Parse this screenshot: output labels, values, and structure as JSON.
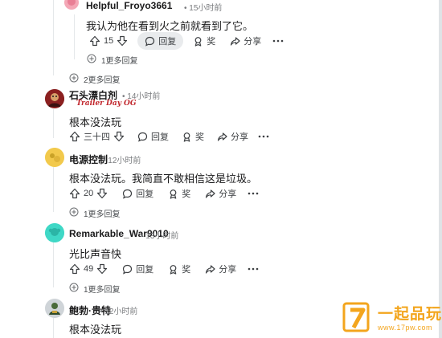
{
  "colors": {
    "watermark": "#f3a51d",
    "hover_pill": "#e9ebed",
    "thread_line": "#e5e8ea",
    "badge_text": "#c1272d"
  },
  "icons": {
    "upvote": "arrow-up-outline",
    "downvote": "arrow-down-outline",
    "reply": "speech-bubble",
    "award": "award-ribbon",
    "share": "share-arrow",
    "more": "ellipsis",
    "expand": "plus-circle"
  },
  "comments": [
    {
      "username": "Helpful_Froyo3661",
      "time": "15小时前",
      "text": "我认为他在看到火之前就看到了它。",
      "votes": "15",
      "reply_label": "回复",
      "award_label": "奖",
      "share_label": "分享",
      "more_replies": "1更多回复"
    },
    {
      "username": "石头漂白剂",
      "time": "14小时前",
      "flair": "Trailer Day OG",
      "text": "根本没法玩",
      "votes": "三十四",
      "reply_label": "回复",
      "award_label": "奖",
      "share_label": "分享"
    },
    {
      "username": "电源控制",
      "time": "12小时前",
      "text": "根本没法玩。我简直不敢相信这是垃圾。",
      "votes": "20",
      "reply_label": "回复",
      "award_label": "奖",
      "share_label": "分享",
      "more_replies": "1更多回复"
    },
    {
      "username": "Remarkable_War9010",
      "time": "13小时前",
      "text": "光比声音快",
      "votes": "49",
      "reply_label": "回复",
      "award_label": "奖",
      "share_label": "分享",
      "more_replies": "1更多回复"
    },
    {
      "username": "鲍勃·贵特",
      "time": "12小时前",
      "text": "根本没法玩"
    }
  ],
  "thread_more_replies": "2更多回复",
  "watermark": {
    "brand": "一起品玩",
    "url": "www.17pw.com"
  }
}
